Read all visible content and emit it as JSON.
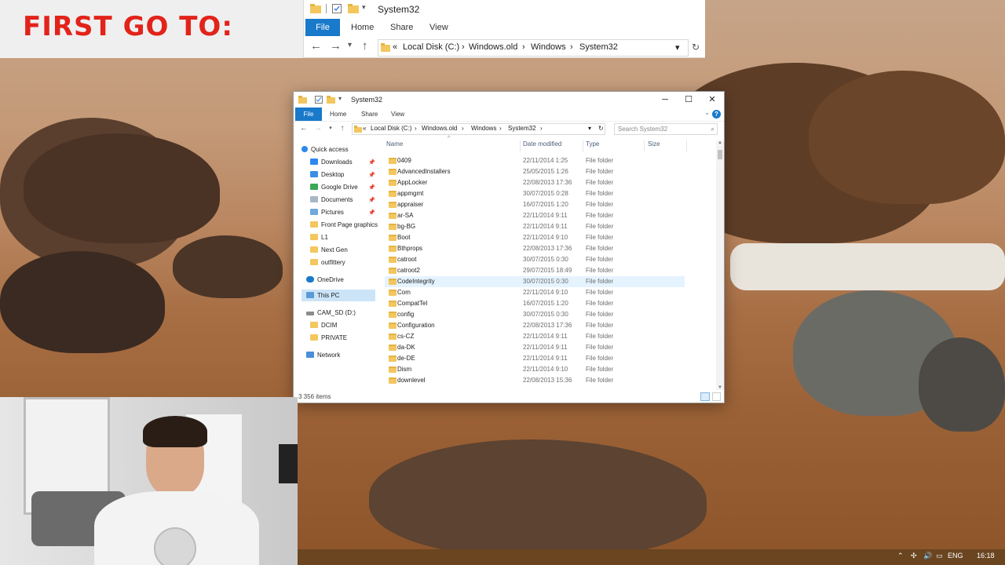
{
  "caption": {
    "text": "FIRST GO TO:"
  },
  "zoom_window": {
    "title": "System32",
    "ribbon": {
      "file": "File",
      "home": "Home",
      "share": "Share",
      "view": "View"
    },
    "path": {
      "overflow": "«",
      "segments": [
        "Local Disk (C:)",
        "Windows.old",
        "Windows",
        "System32"
      ]
    }
  },
  "window": {
    "title": "System32",
    "ribbon": {
      "file": "File",
      "home": "Home",
      "share": "Share",
      "view": "View"
    },
    "path": {
      "overflow": "«",
      "segments": [
        "Local Disk (C:)",
        "Windows.old",
        "Windows",
        "System32"
      ]
    },
    "search_placeholder": "Search System32",
    "columns": {
      "name": "Name",
      "date": "Date modified",
      "type": "Type",
      "size": "Size"
    },
    "status": "3 356 items"
  },
  "nav_pane": {
    "quick_access": "Quick access",
    "quick_items": [
      "Downloads",
      "Desktop",
      "Google Drive",
      "Documents",
      "Pictures",
      "Front Page graphics",
      "L1",
      "Next Gen",
      "outfittery"
    ],
    "onedrive": "OneDrive",
    "this_pc": "This PC",
    "camsd": "CAM_SD (D:)",
    "camsd_items": [
      "DCIM",
      "PRIVATE"
    ],
    "network": "Network"
  },
  "files": [
    {
      "name": "0409",
      "date": "22/11/2014 1:25",
      "type": "File folder"
    },
    {
      "name": "AdvancedInstallers",
      "date": "25/05/2015 1:26",
      "type": "File folder"
    },
    {
      "name": "AppLocker",
      "date": "22/08/2013 17:36",
      "type": "File folder"
    },
    {
      "name": "appmgmt",
      "date": "30/07/2015 0:28",
      "type": "File folder"
    },
    {
      "name": "appraiser",
      "date": "16/07/2015 1:20",
      "type": "File folder"
    },
    {
      "name": "ar-SA",
      "date": "22/11/2014 9:11",
      "type": "File folder"
    },
    {
      "name": "bg-BG",
      "date": "22/11/2014 9:11",
      "type": "File folder"
    },
    {
      "name": "Boot",
      "date": "22/11/2014 9:10",
      "type": "File folder"
    },
    {
      "name": "Bthprops",
      "date": "22/08/2013 17:36",
      "type": "File folder"
    },
    {
      "name": "catroot",
      "date": "30/07/2015 0:30",
      "type": "File folder"
    },
    {
      "name": "catroot2",
      "date": "29/07/2015 18:49",
      "type": "File folder"
    },
    {
      "name": "CodeIntegrity",
      "date": "30/07/2015 0:30",
      "type": "File folder"
    },
    {
      "name": "Com",
      "date": "22/11/2014 9:10",
      "type": "File folder"
    },
    {
      "name": "CompatTel",
      "date": "16/07/2015 1:20",
      "type": "File folder"
    },
    {
      "name": "config",
      "date": "30/07/2015 0:30",
      "type": "File folder"
    },
    {
      "name": "Configuration",
      "date": "22/08/2013 17:36",
      "type": "File folder"
    },
    {
      "name": "cs-CZ",
      "date": "22/11/2014 9:11",
      "type": "File folder"
    },
    {
      "name": "da-DK",
      "date": "22/11/2014 9:11",
      "type": "File folder"
    },
    {
      "name": "de-DE",
      "date": "22/11/2014 9:11",
      "type": "File folder"
    },
    {
      "name": "Dism",
      "date": "22/11/2014 9:10",
      "type": "File folder"
    },
    {
      "name": "downlevel",
      "date": "22/08/2013 15:36",
      "type": "File folder"
    }
  ],
  "taskbar": {
    "lang": "ENG",
    "time": "16:18"
  },
  "colors": {
    "accent": "#1979ca",
    "caption": "#e2231a",
    "selection": "#cce4f7",
    "hover": "#e5f3ff",
    "folder": "#f3c75e"
  }
}
